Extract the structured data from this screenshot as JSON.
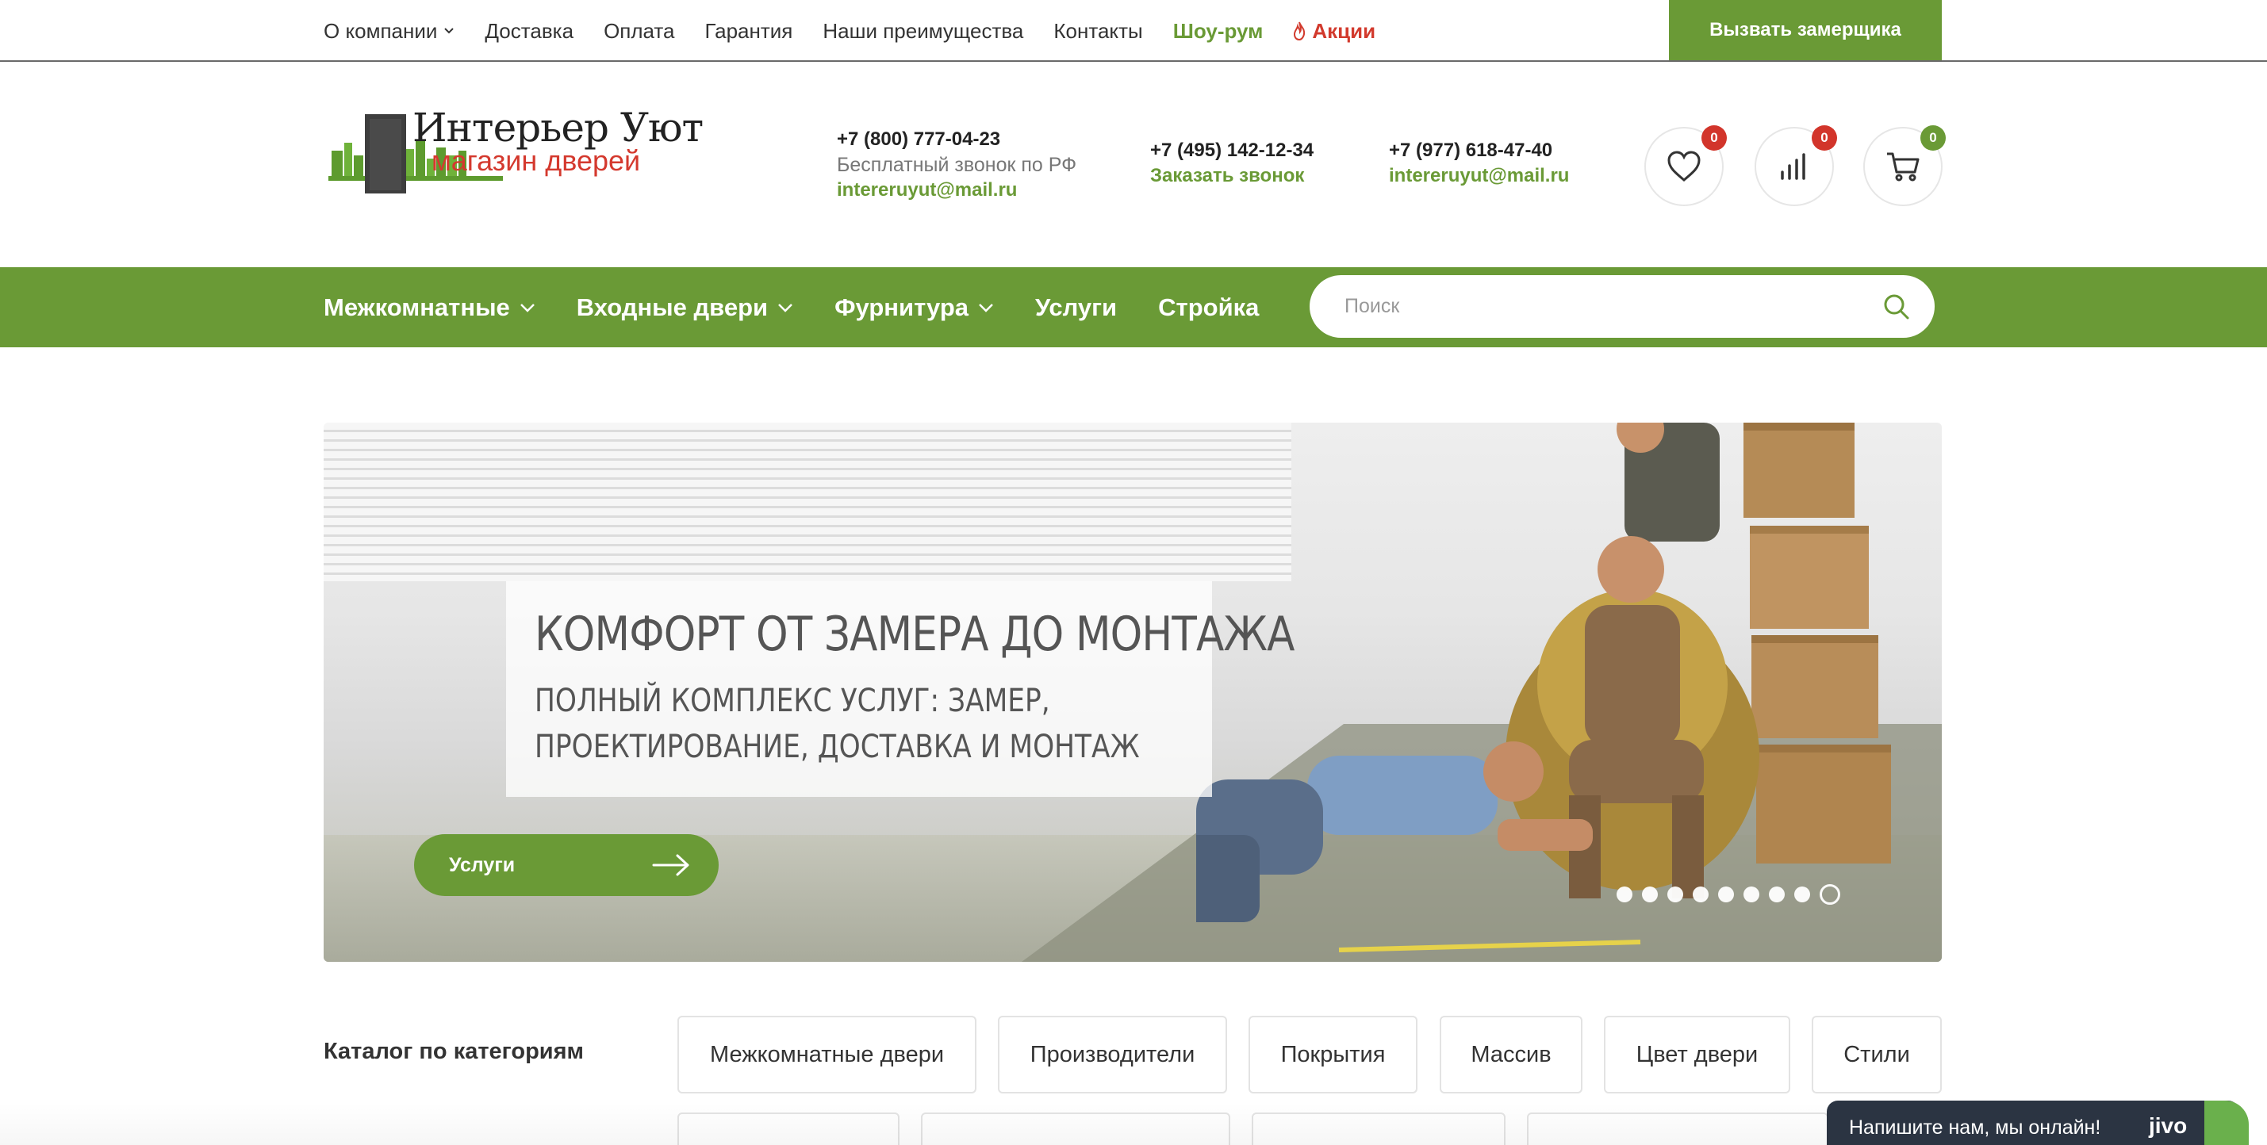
{
  "topnav": {
    "items": [
      "О компании",
      "Доставка",
      "Оплата",
      "Гарантия",
      "Наши преимущества",
      "Контакты"
    ],
    "showroom": "Шоу-рум",
    "promo": "Акции",
    "call_button": "Вызвать замерщика"
  },
  "logo": {
    "line1": "Интерьер Уют",
    "line2": "магазин дверей"
  },
  "contacts": {
    "main_phone": "+7 (800) 777-04-23",
    "main_note": "Бесплатный звонок по РФ",
    "main_email": "intereruyut@mail.ru",
    "phone2": "+7 (495) 142-12-34",
    "callback": "Заказать звонок",
    "phone3": "+7 (977) 618-47-40",
    "email3": "intereruyut@mail.ru"
  },
  "header_icons": {
    "favorites_count": "0",
    "compare_count": "0",
    "cart_count": "0"
  },
  "mainnav": {
    "items": [
      "Межкомнатные",
      "Входные двери",
      "Фурнитура",
      "Услуги",
      "Стройка"
    ]
  },
  "search": {
    "placeholder": "Поиск"
  },
  "banner": {
    "title": "КОМФОРТ ОТ ЗАМЕРА ДО МОНТАЖА",
    "subtitle": "ПОЛНЫЙ КОМПЛЕКС УСЛУГ: ЗАМЕР, ПРОЕКТИРОВАНИЕ, ДОСТАВКА И МОНТАЖ",
    "button": "Услуги",
    "slides_total": 9,
    "active_slide": 9
  },
  "catalog": {
    "label": "Каталог по категориям",
    "chips": [
      "Межкомнатные двери",
      "Производители",
      "Покрытия",
      "Массив",
      "Цвет двери",
      "Стили"
    ]
  },
  "chat": {
    "text": "Напишите нам, мы онлайн!",
    "brand": "jivo"
  },
  "colors": {
    "brand_green": "#6a9a36",
    "promo_red": "#d23a2d",
    "badge_red": "#d2352b",
    "badge_green": "#6a9a36"
  }
}
